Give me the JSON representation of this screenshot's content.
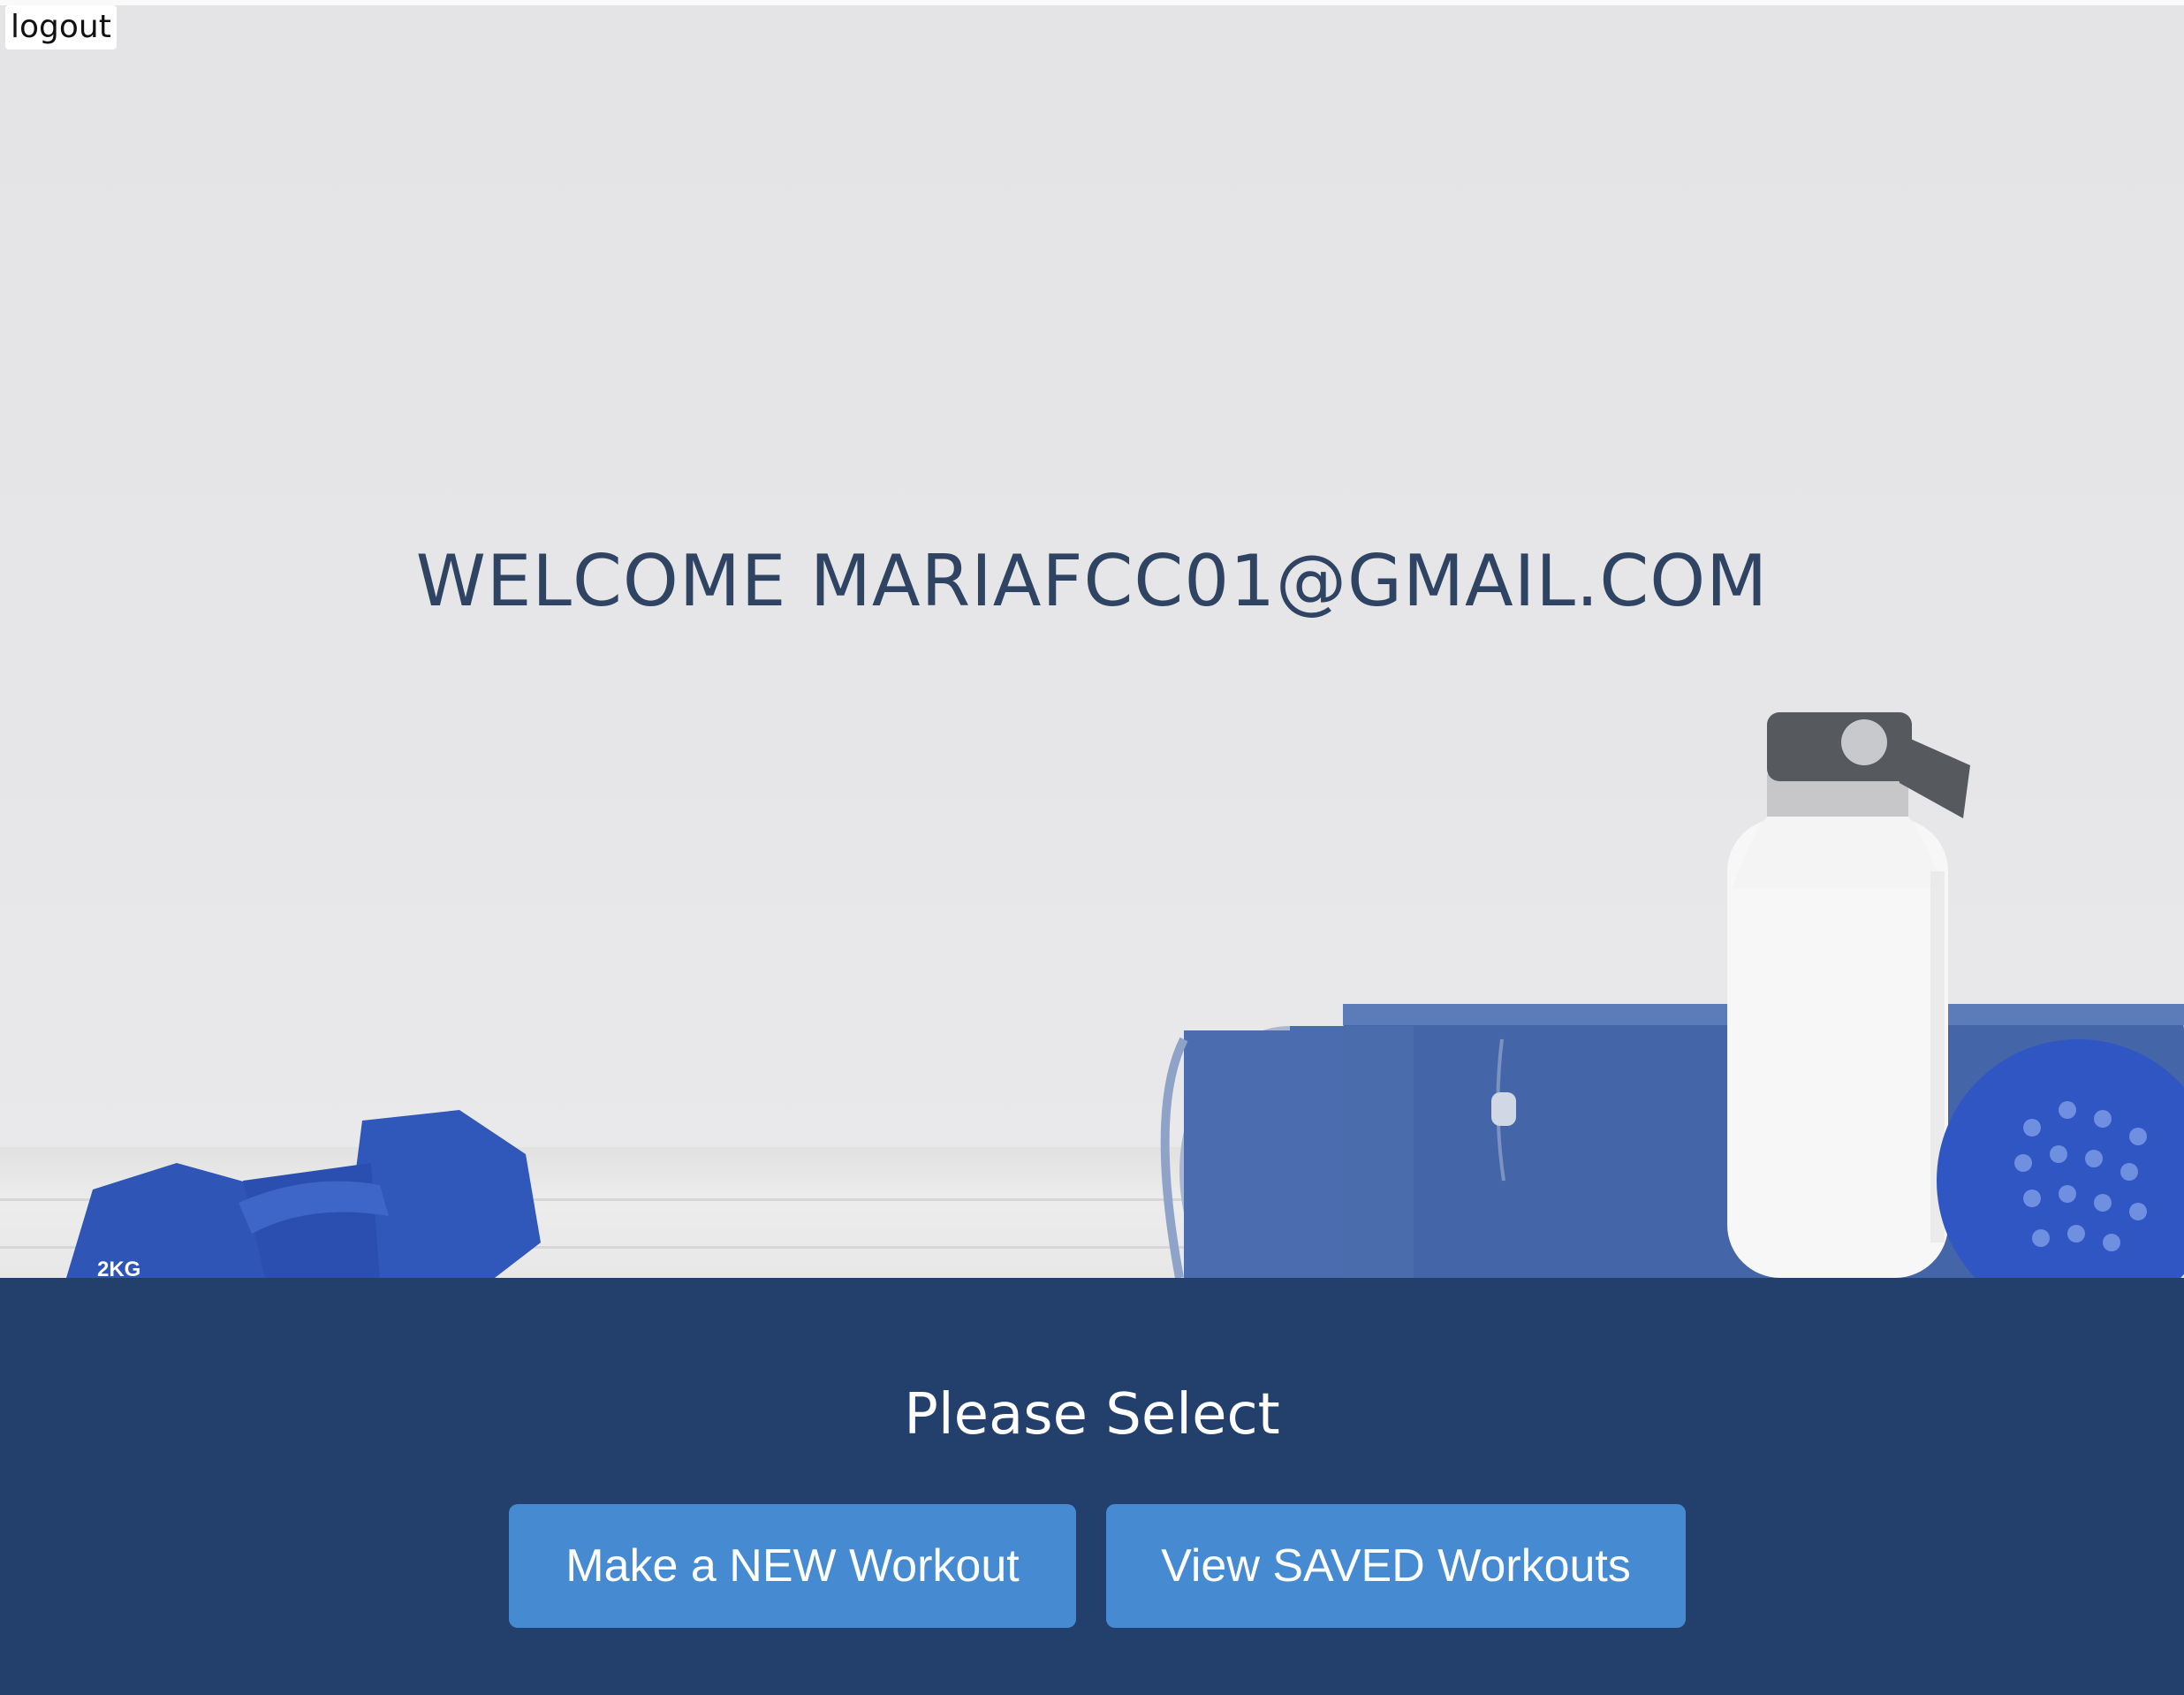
{
  "header": {
    "logout_label": "logout"
  },
  "hero": {
    "welcome_text": "WELCOME MARIAFCC01@GMAIL.COM",
    "illustration": {
      "dumbbell_label": "2KG"
    }
  },
  "selection": {
    "title": "Please Select",
    "buttons": {
      "new_workout": "Make a NEW Workout",
      "saved_workouts": "View SAVED Workouts"
    }
  },
  "colors": {
    "panel_background": "#233f6b",
    "button_background": "#468bd1",
    "welcome_text": "#2f4462",
    "hero_background": "#e4e4e6"
  }
}
